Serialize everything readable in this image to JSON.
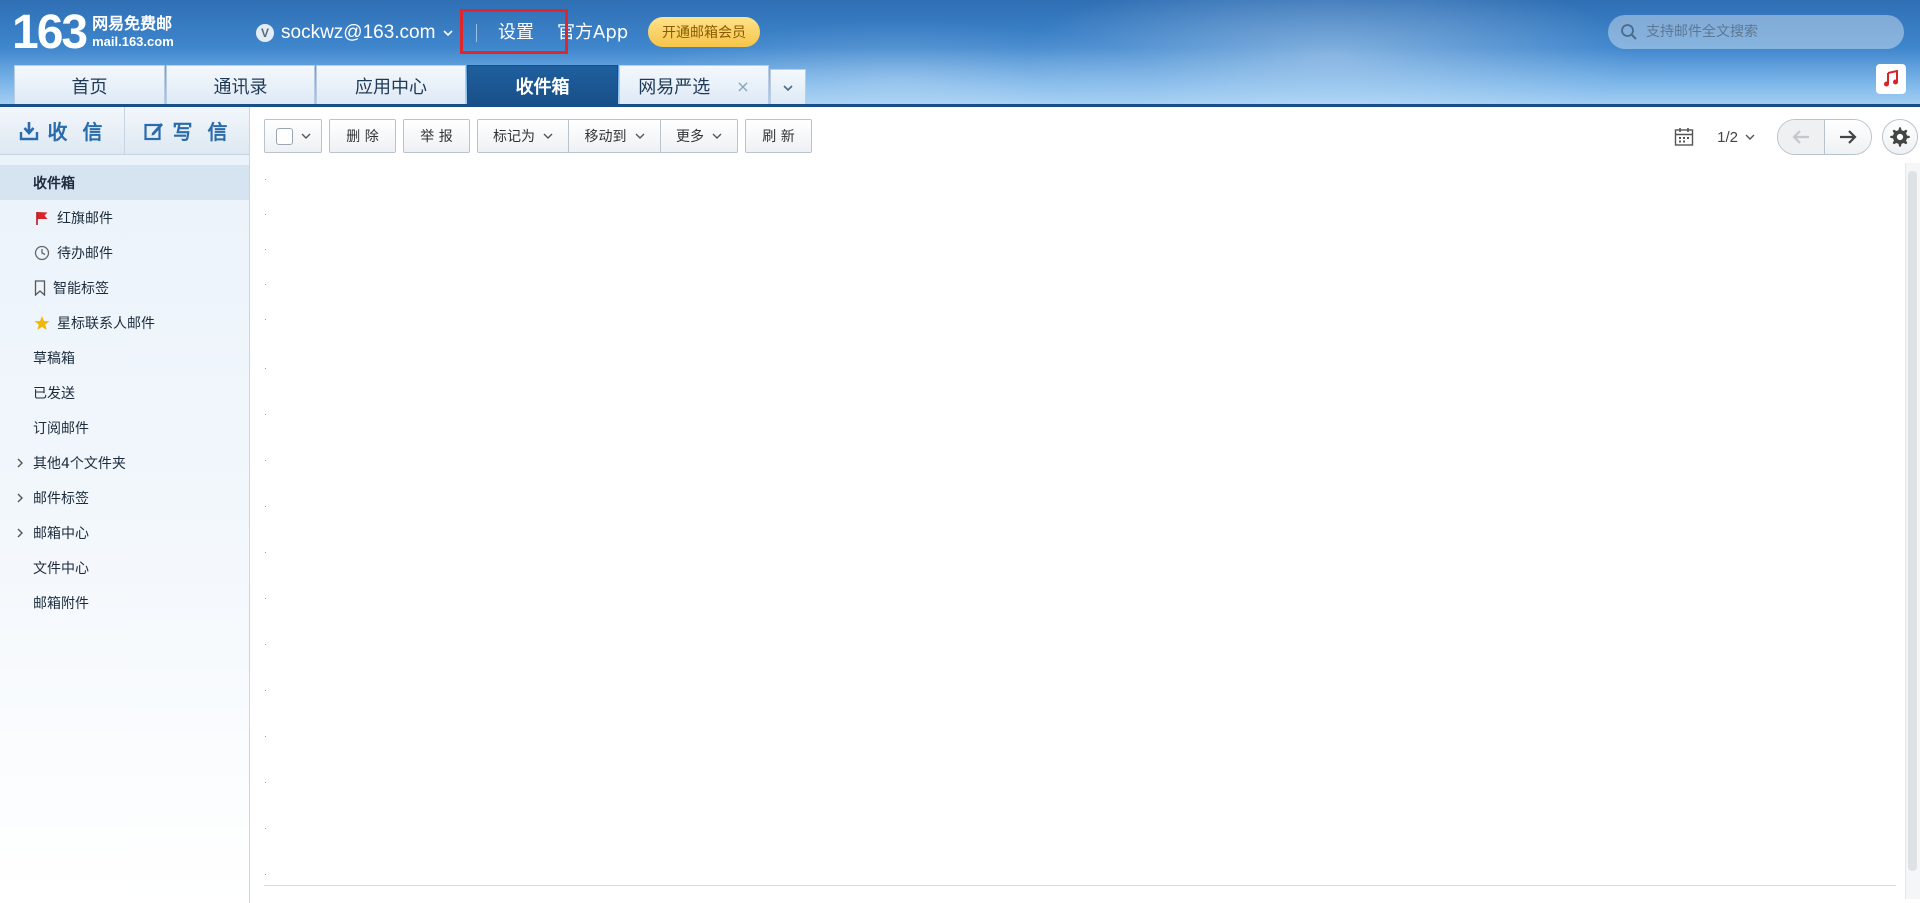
{
  "header": {
    "logo_number": "163",
    "logo_cn": "网易免费邮",
    "logo_url": "mail.163.com",
    "account_badge": "V",
    "account_email": "sockwz@163.com",
    "settings_label": "设置",
    "app_label": "官方App",
    "vip_button": "开通邮箱会员",
    "search_placeholder": "支持邮件全文搜索",
    "highlight_color": "#e0262b"
  },
  "tabs": [
    {
      "label": "首页",
      "active": false
    },
    {
      "label": "通讯录",
      "active": false
    },
    {
      "label": "应用中心",
      "active": false
    },
    {
      "label": "收件箱",
      "active": true
    },
    {
      "label": "网易严选",
      "active": false,
      "closable": true
    }
  ],
  "tab_close_glyph": "×",
  "sidebar": {
    "receive_label": "收 信",
    "write_label": "写 信",
    "folders": [
      {
        "label": "收件箱",
        "icon": "",
        "active": true
      },
      {
        "label": "红旗邮件",
        "icon": "red-flag-icon"
      },
      {
        "label": "待办邮件",
        "icon": "clock-icon"
      },
      {
        "label": "智能标签",
        "icon": "bookmark-icon"
      },
      {
        "label": "星标联系人邮件",
        "icon": "star-icon"
      },
      {
        "label": "草稿箱",
        "icon": ""
      },
      {
        "label": "已发送",
        "icon": ""
      },
      {
        "label": "订阅邮件",
        "icon": ""
      },
      {
        "label": "其他4个文件夹",
        "icon": "",
        "expandable": true
      },
      {
        "label": "邮件标签",
        "icon": "",
        "expandable": true
      },
      {
        "label": "邮箱中心",
        "icon": "",
        "expandable": true
      },
      {
        "label": "文件中心",
        "icon": ""
      },
      {
        "label": "邮箱附件",
        "icon": ""
      }
    ]
  },
  "toolbar": {
    "delete": "删 除",
    "report": "举 报",
    "mark_as": "标记为",
    "move_to": "移动到",
    "more": "更多",
    "refresh": "刷 新"
  },
  "pager": {
    "page": "1/2"
  },
  "colors": {
    "accent": "#184f88",
    "link_blue": "#2a6bab",
    "vip_yellow": "#f6c548"
  }
}
